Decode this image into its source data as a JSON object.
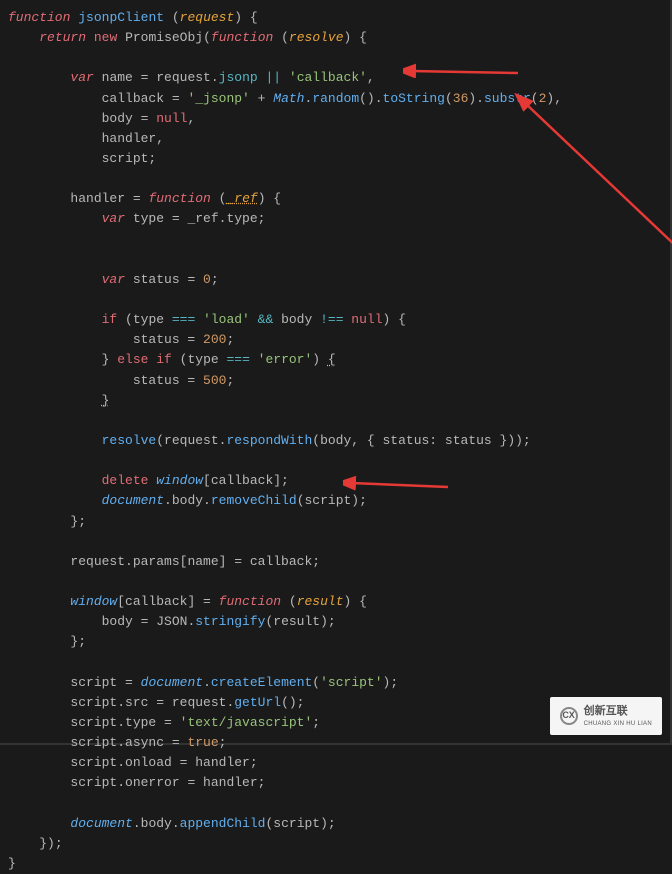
{
  "code": {
    "line1": {
      "function": "function",
      "name": "jsonpClient",
      "param": "request",
      "open": ") {"
    },
    "line2": {
      "return": "return",
      "new": "new",
      "ctor": "PromiseObj(",
      "function": "function",
      "param": "resolve",
      "open": ") {"
    },
    "line4": {
      "var": "var",
      "name": "name = request.",
      "jsonp": "jsonp",
      "or": " || ",
      "str": "'callback'",
      "comma": ","
    },
    "line5": {
      "callback": "callback = ",
      "str1": "'_jsonp'",
      "plus": " + ",
      "math": "Math",
      "dot": ".",
      "random": "random",
      "call": "().",
      "toString": "toString",
      "p36": "36",
      "substr": "substr",
      "p2": "2"
    },
    "line6": {
      "body": "body = ",
      "null": "null"
    },
    "line7": "handler,",
    "line8": "script;",
    "line10": {
      "handler": "handler = ",
      "function": "function",
      "param": "_ref",
      "open": ") {"
    },
    "line11": {
      "var": "var",
      "rest": " type = _ref.type;"
    },
    "line14": {
      "var": "var",
      "status": " status = ",
      "zero": "0"
    },
    "line16": {
      "if": "if",
      "open": " (type ",
      "eq": "===",
      "str": " 'load'",
      "and": " && ",
      "body": "body ",
      "neq": "!==",
      "null": " null",
      "bracket": ") {"
    },
    "line17": {
      "status": "status = ",
      "n200": "200"
    },
    "line18": {
      "close": "} ",
      "else": "else",
      "if": " if",
      "open": " (type ",
      "eq": "===",
      "str": " 'error'",
      "bracket": ") ",
      "brace": "{"
    },
    "line19": {
      "status": "status = ",
      "n500": "500"
    },
    "line20": "}",
    "line22": {
      "resolve": "resolve",
      "open": "(request.",
      "respondWith": "respondWith",
      "args": "(body, { status: status }));"
    },
    "line24": {
      "delete": "delete",
      "window": " window",
      "bracket": "[callback];"
    },
    "line25": {
      "document": "document",
      "body": ".body.",
      "removeChild": "removeChild",
      "args": "(script);"
    },
    "line26": "};",
    "line28": "request.params[name] = callback;",
    "line30": {
      "window": "window",
      "bracket": "[callback] = ",
      "function": "function",
      "param": "result",
      "open": ") {"
    },
    "line31": {
      "body": "body = JSON.",
      "stringify": "stringify",
      "args": "(result);"
    },
    "line32": "};",
    "line34": {
      "script": "script = ",
      "document": "document",
      "dot": ".",
      "createElement": "createElement",
      "str": "'script'"
    },
    "line35": {
      "src": "script.src = request.",
      "getUrl": "getUrl",
      "call": "();"
    },
    "line36": {
      "type": "script.type = ",
      "str": "'text/javascript'"
    },
    "line37": {
      "async": "script.async = ",
      "true": "true"
    },
    "line38": "script.onload = handler;",
    "line39": "script.onerror = handler;",
    "line41": {
      "document": "document",
      "body": ".body.",
      "appendChild": "appendChild",
      "args": "(script);"
    },
    "line42": "});",
    "line43": "}"
  },
  "watermark": {
    "text": "创新互联",
    "subtext": "CHUANG XIN HU LIAN"
  }
}
